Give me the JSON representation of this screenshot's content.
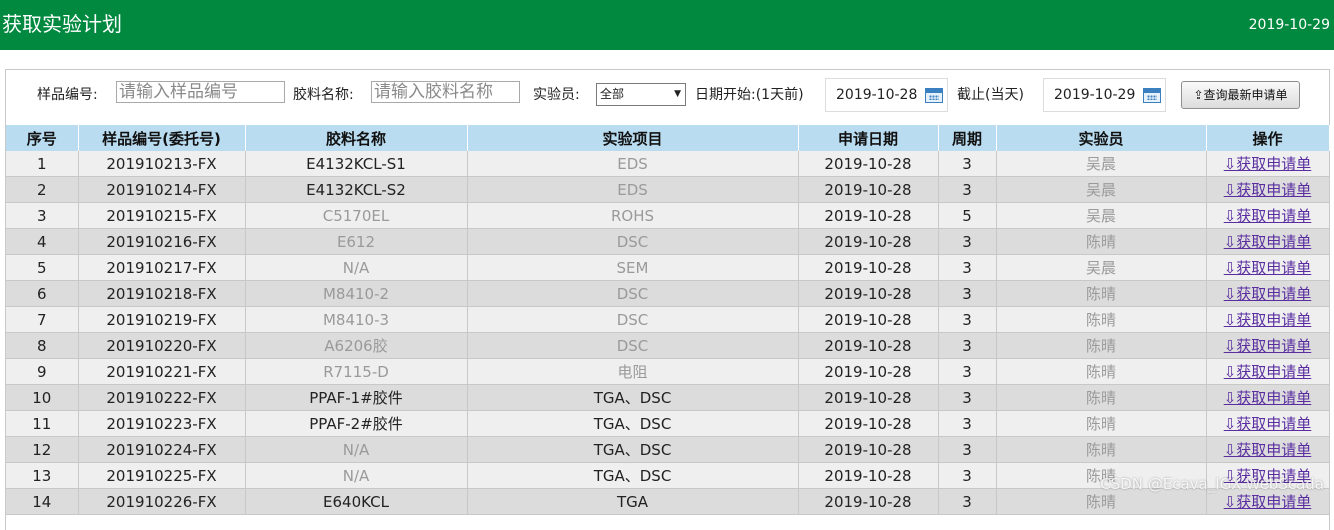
{
  "header": {
    "title": "获取实验计划",
    "date": "2019-10-29"
  },
  "filter": {
    "sample_label": "样品编号:",
    "sample_placeholder": "请输入样品编号",
    "glue_label": "胶料名称:",
    "glue_placeholder": "请输入胶料名称",
    "tester_label": "实验员:",
    "tester_value": "全部",
    "start_label": "日期开始:(1天前)",
    "start_value": "2019-10-28",
    "end_label": "截止(当天)",
    "end_value": "2019-10-29",
    "query_button": "⇪查询最新申请单"
  },
  "table": {
    "columns": [
      "序号",
      "样品编号(委托号)",
      "胶料名称",
      "实验项目",
      "申请日期",
      "周期",
      "实验员",
      "操作"
    ],
    "action_label": "⇩获取申请单",
    "rows": [
      {
        "no": "1",
        "sample": "201910213-FX",
        "glue": "E4132KCL-S1",
        "item": "EDS",
        "date": "2019-10-28",
        "period": "3",
        "tester": "吴晨"
      },
      {
        "no": "2",
        "sample": "201910214-FX",
        "glue": "E4132KCL-S2",
        "item": "EDS",
        "date": "2019-10-28",
        "period": "3",
        "tester": "吴晨"
      },
      {
        "no": "3",
        "sample": "201910215-FX",
        "glue": "C5170EL",
        "item": "ROHS",
        "date": "2019-10-28",
        "period": "5",
        "tester": "吴晨"
      },
      {
        "no": "4",
        "sample": "201910216-FX",
        "glue": "E612",
        "item": "DSC",
        "date": "2019-10-28",
        "period": "3",
        "tester": "陈晴"
      },
      {
        "no": "5",
        "sample": "201910217-FX",
        "glue": "N/A",
        "item": "SEM",
        "date": "2019-10-28",
        "period": "3",
        "tester": "吴晨"
      },
      {
        "no": "6",
        "sample": "201910218-FX",
        "glue": "M8410-2",
        "item": "DSC",
        "date": "2019-10-28",
        "period": "3",
        "tester": "陈晴"
      },
      {
        "no": "7",
        "sample": "201910219-FX",
        "glue": "M8410-3",
        "item": "DSC",
        "date": "2019-10-28",
        "period": "3",
        "tester": "陈晴"
      },
      {
        "no": "8",
        "sample": "201910220-FX",
        "glue": "A6206胶",
        "item": "DSC",
        "date": "2019-10-28",
        "period": "3",
        "tester": "陈晴"
      },
      {
        "no": "9",
        "sample": "201910221-FX",
        "glue": "R7115-D",
        "item": "电阻",
        "date": "2019-10-28",
        "period": "3",
        "tester": "陈晴"
      },
      {
        "no": "10",
        "sample": "201910222-FX",
        "glue": "PPAF-1#胶件",
        "item": "TGA、DSC",
        "date": "2019-10-28",
        "period": "3",
        "tester": "陈晴"
      },
      {
        "no": "11",
        "sample": "201910223-FX",
        "glue": "PPAF-2#胶件",
        "item": "TGA、DSC",
        "date": "2019-10-28",
        "period": "3",
        "tester": "陈晴"
      },
      {
        "no": "12",
        "sample": "201910224-FX",
        "glue": "N/A",
        "item": "TGA、DSC",
        "date": "2019-10-28",
        "period": "3",
        "tester": "陈晴"
      },
      {
        "no": "13",
        "sample": "201910225-FX",
        "glue": "N/A",
        "item": "TGA、DSC",
        "date": "2019-10-28",
        "period": "3",
        "tester": "陈晴"
      },
      {
        "no": "14",
        "sample": "201910226-FX",
        "glue": "E640KCL",
        "item": "TGA",
        "date": "2019-10-28",
        "period": "3",
        "tester": "陈晴"
      }
    ]
  },
  "watermark": "CSDN @Ecava_IGX-WebScada"
}
